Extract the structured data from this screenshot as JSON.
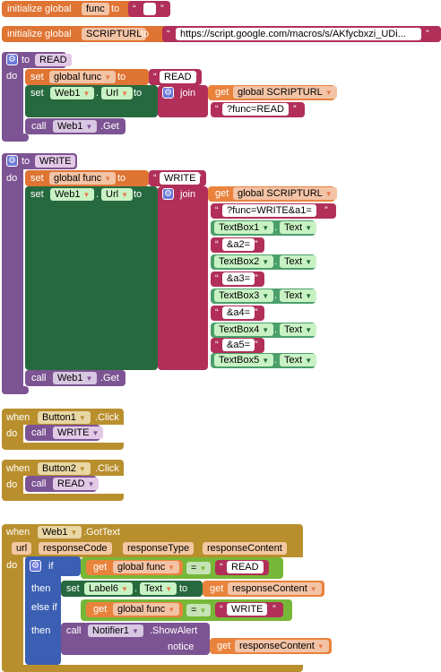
{
  "globals": [
    {
      "kw": "initialize global",
      "name": "func",
      "to": "to",
      "value": " "
    },
    {
      "kw": "initialize global",
      "name": "SCRIPTURL",
      "to": "to",
      "value": "https://script.google.com/macros/s/AKfycbxzi_UDi..."
    }
  ],
  "read_proc": {
    "to": "to",
    "name": "READ",
    "do": "do",
    "set_kw": "set",
    "var": "global func",
    "to_kw": "to",
    "value": "READ",
    "set2": "set",
    "comp": "Web1",
    "prop": "Url",
    "to2": "to",
    "join": "join",
    "get": "get",
    "get_var": "global SCRIPTURL",
    "suffix": "?func=READ",
    "call": "call",
    "call_comp": "Web1",
    "method": ".Get"
  },
  "write_proc": {
    "to": "to",
    "name": "WRITE",
    "do": "do",
    "set_kw": "set",
    "var": "global func",
    "to_kw": "to",
    "value": "WRITE",
    "set2": "set",
    "comp": "Web1",
    "prop": "Url",
    "to2": "to",
    "join": "join",
    "get": "get",
    "get_var": "global SCRIPTURL",
    "items": [
      {
        "kind": "text",
        "value": "?func=WRITE&a1="
      },
      {
        "kind": "comp",
        "comp": "TextBox1",
        "prop": "Text"
      },
      {
        "kind": "text",
        "value": "&a2="
      },
      {
        "kind": "comp",
        "comp": "TextBox2",
        "prop": "Text"
      },
      {
        "kind": "text",
        "value": "&a3="
      },
      {
        "kind": "comp",
        "comp": "TextBox3",
        "prop": "Text"
      },
      {
        "kind": "text",
        "value": "&a4="
      },
      {
        "kind": "comp",
        "comp": "TextBox4",
        "prop": "Text"
      },
      {
        "kind": "text",
        "value": "&a5="
      },
      {
        "kind": "comp",
        "comp": "TextBox5",
        "prop": "Text"
      }
    ],
    "call": "call",
    "call_comp": "Web1",
    "method": ".Get"
  },
  "button1": {
    "when": "when",
    "comp": "Button1",
    "event": ".Click",
    "do": "do",
    "call": "call",
    "proc": "WRITE"
  },
  "button2": {
    "when": "when",
    "comp": "Button2",
    "event": ".Click",
    "do": "do",
    "call": "call",
    "proc": "READ"
  },
  "gottext": {
    "when": "when",
    "comp": "Web1",
    "event": ".GotText",
    "params": [
      "url",
      "responseCode",
      "responseType",
      "responseContent"
    ],
    "do": "do",
    "if": "if",
    "then": "then",
    "else_if": "else if",
    "then2": "then",
    "get": "get",
    "cond_var": "global func",
    "eq": "=",
    "read": "READ",
    "write": "WRITE",
    "set": "set",
    "set_comp": "Label6",
    "set_prop": "Text",
    "to": "to",
    "resp": "responseContent",
    "call": "call",
    "notifier": "Notifier1",
    "method": ".ShowAlert",
    "notice": "notice"
  }
}
